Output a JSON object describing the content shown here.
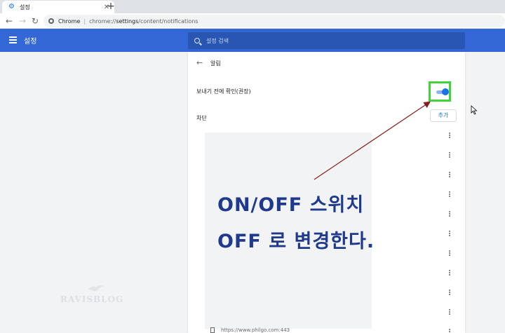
{
  "tab": {
    "title": "설정",
    "icon": "gear-icon"
  },
  "address_bar": {
    "site_label": "Chrome",
    "separator": "|",
    "url_host": "chrome://",
    "url_path_bold": "settings",
    "url_rest": "/content/notifications"
  },
  "header": {
    "title": "설정",
    "search_placeholder": "설정 검색"
  },
  "subpage": {
    "title": "알림"
  },
  "settings": {
    "ask_label": "보내기 전에 확인(권장)",
    "ask_toggle_on": true,
    "block_label": "차단",
    "add_label": "추가"
  },
  "site_list": {
    "last_site": "https://www.philgo.com:443"
  },
  "annotation": {
    "line1": "ON/OFF 스위치",
    "line2": "OFF 로 변경한다."
  },
  "watermark": {
    "text": "RAVISBLOG"
  },
  "colors": {
    "header_blue": "#3367d6",
    "toggle_blue": "#1a73e8",
    "highlight_green": "#3fd43a",
    "annotation_text": "#1f3a8c",
    "arrow": "#8b1a1a"
  }
}
